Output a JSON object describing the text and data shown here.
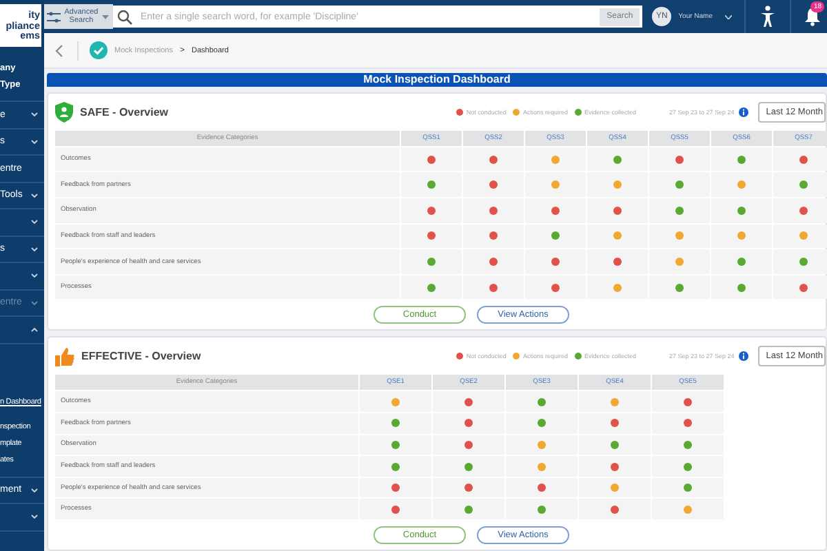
{
  "sidebar": {
    "logo_lines": [
      "ity",
      "pliance",
      "ems"
    ],
    "company_lines": [
      "any",
      "Type"
    ],
    "items": [
      {
        "label": "e",
        "expanded": false,
        "disabled": false
      },
      {
        "label": "s",
        "expanded": false,
        "disabled": false
      },
      {
        "label": "entre",
        "disabled": false
      },
      {
        "label": "Tools",
        "expanded": false,
        "disabled": false
      },
      {
        "expanded": false,
        "disabled": false
      },
      {
        "label": "s",
        "expanded": false,
        "disabled": false
      },
      {
        "expanded": false,
        "disabled": false
      },
      {
        "label": "entre",
        "expanded": false,
        "disabled": true
      },
      {
        "expanded": true,
        "disabled": false,
        "children": [
          {
            "label": "n Dashboard",
            "selected": true
          },
          {
            "label": "nspection",
            "selected": false
          },
          {
            "label": "mplate",
            "selected": false
          },
          {
            "label": "ates",
            "selected": false
          }
        ]
      },
      {
        "label": "ment",
        "expanded": false,
        "disabled": false
      },
      {
        "expanded": false,
        "disabled": false
      }
    ]
  },
  "topbar": {
    "advanced_search": "Advanced Search",
    "search": {
      "placeholder": "Enter a single search word, for example 'Discipline'"
    },
    "search_button": "Search",
    "avatar": "YN",
    "user_name": "Your Name",
    "notifications": "18"
  },
  "breadcrumb": [
    "Mock Inspections",
    "Dashboard"
  ],
  "breadcrumb_separator": ">",
  "dashboard_title": "Mock Inspection Dashboard",
  "sections": [
    {
      "kind": "safe",
      "title": "SAFE - Overview",
      "legend": [
        {
          "label": "Not conducted",
          "color": "#e0524a"
        },
        {
          "label": "Actions required",
          "color": "#f0a830"
        },
        {
          "label": "Evidence collected",
          "color": "#5aa930"
        }
      ],
      "date_range": "27 Sep 23 to 27 Sep 24",
      "period": "Last 12 Month",
      "category_header": "Evidence Categories",
      "columns": [
        "QSS1",
        "QSS2",
        "QSS3",
        "QSS4",
        "QSS5",
        "QSS6",
        "QSS7"
      ],
      "rows": [
        {
          "label": "Outcomes",
          "cells": [
            {
              "color": "#e0524a"
            },
            {
              "color": "#e0524a"
            },
            {
              "color": "#f0a830"
            },
            {
              "color": "#5aa930"
            },
            {
              "color": "#e0524a"
            },
            {
              "color": "#5aa930"
            },
            {
              "color": "#e0524a"
            }
          ]
        },
        {
          "label": "Feedback from partners",
          "cells": [
            {
              "color": "#5aa930"
            },
            {
              "color": "#e0524a"
            },
            {
              "color": "#f0a830"
            },
            {
              "color": "#f0a830"
            },
            {
              "color": "#5aa930"
            },
            {
              "color": "#f0a830"
            },
            {
              "color": "#5aa930"
            }
          ]
        },
        {
          "label": "Observation",
          "cells": [
            {
              "color": "#e0524a"
            },
            {
              "color": "#e0524a"
            },
            {
              "color": "#e0524a"
            },
            {
              "color": "#e0524a"
            },
            {
              "color": "#5aa930"
            },
            {
              "color": "#5aa930"
            },
            {
              "color": "#e0524a"
            }
          ]
        },
        {
          "label": "Feedback from staff and leaders",
          "cells": [
            {
              "color": "#e0524a"
            },
            {
              "color": "#e0524a"
            },
            {
              "color": "#5aa930"
            },
            {
              "color": "#f0a830"
            },
            {
              "color": "#f0a830"
            },
            {
              "color": "#f0a830"
            },
            {
              "color": "#f0a830"
            }
          ]
        },
        {
          "label": "People's experience of health and care services",
          "cells": [
            {
              "color": "#5aa930"
            },
            {
              "color": "#e0524a"
            },
            {
              "color": "#e0524a"
            },
            {
              "color": "#e0524a"
            },
            {
              "color": "#f0a830"
            },
            {
              "color": "#5aa930"
            },
            {
              "color": "#5aa930"
            }
          ]
        },
        {
          "label": "Processes",
          "cells": [
            {
              "color": "#5aa930"
            },
            {
              "color": "#e0524a"
            },
            {
              "color": "#e0524a"
            },
            {
              "color": "#f0a830"
            },
            {
              "color": "#5aa930"
            },
            {
              "color": "#5aa930"
            },
            {
              "color": "#e0524a"
            }
          ]
        }
      ],
      "buttons": [
        "Conduct",
        "View Actions"
      ]
    },
    {
      "kind": "effective",
      "title": "EFFECTIVE - Overview",
      "legend": [
        {
          "label": "Not conducted",
          "color": "#e0524a"
        },
        {
          "label": "Actions required",
          "color": "#f0a830"
        },
        {
          "label": "Evidence collected",
          "color": "#5aa930"
        }
      ],
      "date_range": "27 Sep 23 to 27 Sep 24",
      "period": "Last 12 Month",
      "category_header": "Evidence Categories",
      "columns": [
        "QSE1",
        "QSE2",
        "QSE3",
        "QSE4",
        "QSE5"
      ],
      "rows": [
        {
          "label": "Outcomes",
          "cells": [
            {
              "color": "#f0a830"
            },
            {
              "color": "#e0524a"
            },
            {
              "color": "#5aa930"
            },
            {
              "color": "#f0a830"
            },
            {
              "color": "#e0524a"
            }
          ]
        },
        {
          "label": "Feedback from partners",
          "cells": [
            {
              "color": "#5aa930"
            },
            {
              "color": "#e0524a"
            },
            {
              "color": "#5aa930"
            },
            {
              "color": "#e0524a"
            },
            {
              "color": "#e0524a"
            }
          ]
        },
        {
          "label": "Observation",
          "cells": [
            {
              "color": "#5aa930"
            },
            {
              "color": "#e0524a"
            },
            {
              "color": "#f0a830"
            },
            {
              "color": "#5aa930"
            },
            {
              "color": "#5aa930"
            }
          ]
        },
        {
          "label": "Feedback from staff and leaders",
          "cells": [
            {
              "color": "#5aa930"
            },
            {
              "color": "#5aa930"
            },
            {
              "color": "#f0a830"
            },
            {
              "color": "#e0524a"
            },
            {
              "color": "#5aa930"
            }
          ]
        },
        {
          "label": "People's experience of health and care services",
          "cells": [
            {
              "color": "#e0524a"
            },
            {
              "color": "#e0524a"
            },
            {
              "color": "#e0524a"
            },
            {
              "color": "#f0a830"
            },
            {
              "color": "#5aa930"
            }
          ]
        },
        {
          "label": "Processes",
          "cells": [
            {
              "color": "#e0524a"
            },
            {
              "color": "#5aa930"
            },
            {
              "color": "#5aa930"
            },
            {
              "color": "#e0524a"
            },
            {
              "color": "#f0a830"
            }
          ]
        }
      ],
      "buttons": [
        "Conduct",
        "View Actions"
      ]
    }
  ]
}
